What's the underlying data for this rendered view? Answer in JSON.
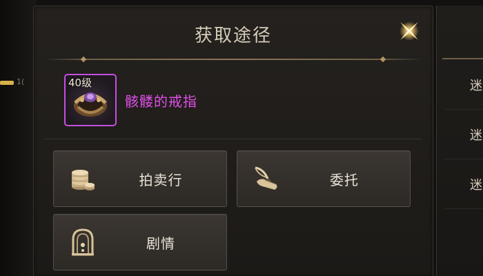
{
  "dialog": {
    "title": "获取途径"
  },
  "item": {
    "level": "40级",
    "name": "骸髅的戒指",
    "rarity_color": "#e04fe8",
    "frame_color": "#c64fe0"
  },
  "sources": [
    {
      "label": "拍卖行",
      "icon": "coin-stack-icon"
    },
    {
      "label": "委托",
      "icon": "scroll-quill-icon"
    },
    {
      "label": "剧情",
      "icon": "arch-gate-icon"
    }
  ],
  "right_panel": {
    "rows": [
      {
        "label": "迷"
      },
      {
        "label": "迷"
      },
      {
        "label": "迷"
      }
    ]
  },
  "left_strip": {
    "fragment": "1("
  },
  "colors": {
    "background": "#121110",
    "title_text": "#d6ccb9",
    "button_text": "#eae3d6",
    "gold_accent": "#d6b24a"
  }
}
